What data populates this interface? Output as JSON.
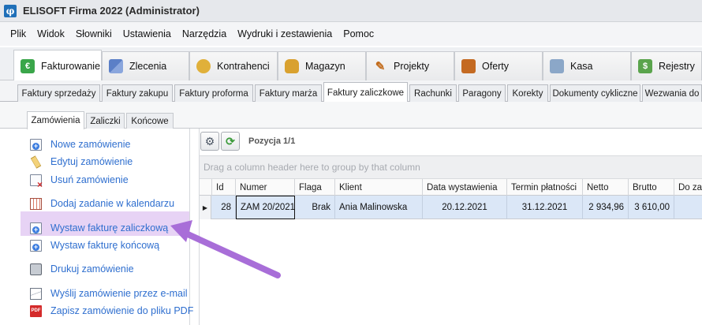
{
  "window": {
    "title": "ELISOFT Firma 2022 (Administrator)",
    "icon": "app-logo-icon"
  },
  "menu": [
    "Plik",
    "Widok",
    "Słowniki",
    "Ustawienia",
    "Narzędzia",
    "Wydruki i zestawienia",
    "Pomoc"
  ],
  "modules": [
    {
      "label": "Fakturowanie",
      "icon": "euro-icon",
      "active": true
    },
    {
      "label": "Zlecenia",
      "icon": "orders-icon"
    },
    {
      "label": "Kontrahenci",
      "icon": "contacts-icon"
    },
    {
      "label": "Magazyn",
      "icon": "warehouse-bag-icon"
    },
    {
      "label": "Projekty",
      "icon": "pen-icon"
    },
    {
      "label": "Oferty",
      "icon": "briefcase-icon"
    },
    {
      "label": "Kasa",
      "icon": "cash-icon"
    },
    {
      "label": "Rejestry",
      "icon": "register-icon"
    }
  ],
  "subtabs": [
    "Faktury sprzedaży",
    "Faktury zakupu",
    "Faktury proforma",
    "Faktury marża",
    "Faktury zaliczkowe",
    "Rachunki",
    "Paragony",
    "Korekty",
    "Dokumenty cykliczne",
    "Wezwania do"
  ],
  "inner_tabs": [
    "Zamówienia",
    "Zaliczki",
    "Końcowe"
  ],
  "actions": [
    {
      "label": "Nowe zamówienie",
      "icon": "new-document-icon"
    },
    {
      "label": "Edytuj zamówienie",
      "icon": "edit-pencil-icon"
    },
    {
      "label": "Usuń zamówienie",
      "icon": "delete-document-icon"
    },
    {
      "label": "Dodaj zadanie w kalendarzu",
      "icon": "calendar-icon"
    },
    {
      "label": "Wystaw fakturę zaliczkową",
      "icon": "new-document-icon",
      "highlighted": true
    },
    {
      "label": "Wystaw fakturę końcową",
      "icon": "new-document-icon"
    },
    {
      "label": "Drukuj zamówienie",
      "icon": "printer-icon"
    },
    {
      "label": "Wyślij zamówienie przez e-mail",
      "icon": "email-icon"
    },
    {
      "label": "Zapisz zamówienie do pliku PDF",
      "icon": "pdf-icon"
    }
  ],
  "grid": {
    "toolbar": {
      "position_label": "Pozycja 1/1"
    },
    "group_hint": "Drag a column header here to group by that column",
    "columns": [
      "Id",
      "Numer",
      "Flaga",
      "Klient",
      "Data wystawienia",
      "Termin płatności",
      "Netto",
      "Brutto",
      "Do zap"
    ],
    "rows": [
      {
        "id": "28",
        "numer": "ZAM 20/2021",
        "flaga": "Brak",
        "klient": "Ania Malinowska",
        "data": "20.12.2021",
        "termin": "31.12.2021",
        "netto": "2 934,96",
        "brutto": "3 610,00",
        "do_zap": ""
      }
    ]
  },
  "annotation": {
    "arrow_color": "#a86ed8",
    "highlight_color": "#e7d3f5"
  }
}
